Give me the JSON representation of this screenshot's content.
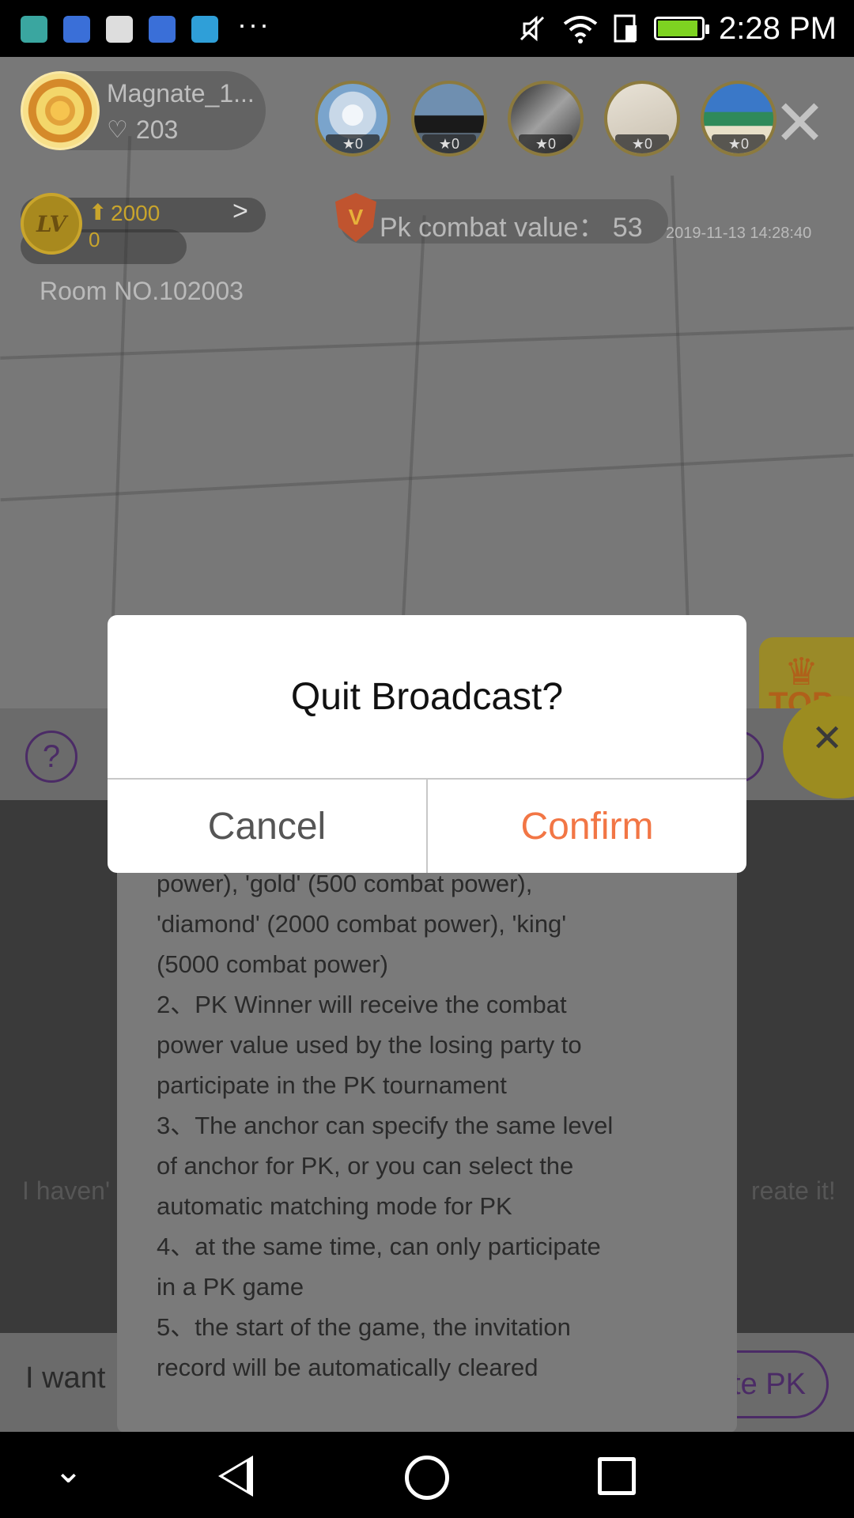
{
  "status_bar": {
    "time": "2:28 PM",
    "more": "···",
    "colors": {
      "android": "#3aa6a0",
      "baidu": "#3a6fd8",
      "font_app": "#dddddd",
      "telegram": "#2f9fd8"
    }
  },
  "room": {
    "host_name": "Magnate_1...",
    "host_likes": "203",
    "viewers": [
      {
        "badge": "★0"
      },
      {
        "badge": "★0"
      },
      {
        "badge": "★0"
      },
      {
        "badge": "★0"
      },
      {
        "badge": "★0"
      }
    ],
    "level_badge": "LV",
    "level_arrow": "⬆",
    "level_value": "2000",
    "level_sub": "0",
    "level_chevron": ">",
    "pk_combat": "Pk combat value：  53",
    "date": "2019-11-13 14:28:40",
    "room_no": "Room NO.102003",
    "top_label": "TOP",
    "close_glyph": "✕"
  },
  "panel": {
    "help": "?",
    "bg_text_left": "I haven'",
    "bg_text_right": "reate it!",
    "bottom_input": "I want",
    "create_pk": "te PK",
    "rules_lines": [
      "power), 'gold' (500 combat power),",
      "'diamond' (2000 combat power), 'king'",
      "(5000 combat power)",
      "2、PK Winner will receive the combat",
      "power value used by the losing party to",
      "participate in the PK tournament",
      "3、The anchor can specify the same level",
      "of anchor for PK, or you can select the",
      "automatic matching mode for PK",
      "4、at the same time, can only participate",
      "in a PK game",
      "5、the start of the game, the invitation",
      "record will be automatically cleared"
    ]
  },
  "dialog": {
    "title": "Quit Broadcast?",
    "cancel": "Cancel",
    "confirm": "Confirm",
    "confirm_color": "#f27645"
  },
  "nav": {
    "chevron": "⌄"
  }
}
